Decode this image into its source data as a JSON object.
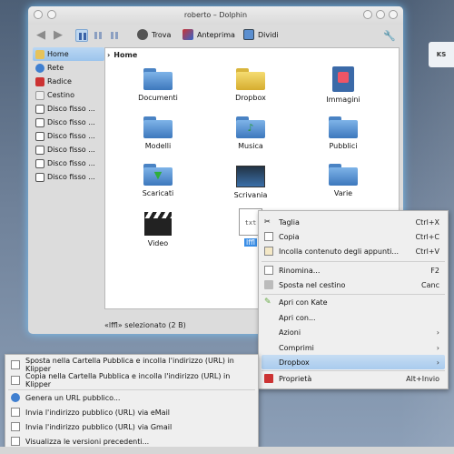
{
  "desktop": {
    "logo_text": "KS"
  },
  "window": {
    "title": "roberto – Dolphin",
    "toolbar": {
      "find_label": "Trova",
      "preview_label": "Anteprima",
      "split_label": "Dividi"
    },
    "sidebar": {
      "items": [
        {
          "label": "Home",
          "icon": "home-icon",
          "selected": true
        },
        {
          "label": "Rete",
          "icon": "network-icon"
        },
        {
          "label": "Radice",
          "icon": "root-icon"
        },
        {
          "label": "Cestino",
          "icon": "trash-icon"
        },
        {
          "label": "Disco fisso ...",
          "icon": "disk-icon"
        },
        {
          "label": "Disco fisso ...",
          "icon": "disk-icon"
        },
        {
          "label": "Disco fisso ...",
          "icon": "disk-icon"
        },
        {
          "label": "Disco fisso ...",
          "icon": "disk-icon"
        },
        {
          "label": "Disco fisso ...",
          "icon": "disk-icon"
        },
        {
          "label": "Disco fisso ...",
          "icon": "disk-icon"
        }
      ]
    },
    "breadcrumb": "Home",
    "files": [
      {
        "name": "Documenti"
      },
      {
        "name": "Dropbox"
      },
      {
        "name": "Immagini"
      },
      {
        "name": "Modelli"
      },
      {
        "name": "Musica"
      },
      {
        "name": "Pubblici"
      },
      {
        "name": "Scaricati"
      },
      {
        "name": "Scrivania"
      },
      {
        "name": "Varie"
      },
      {
        "name": "Video"
      },
      {
        "name": "lffl",
        "file_icon_text": "txt"
      }
    ],
    "status": "«lffl» selezionato (2 B)"
  },
  "context_menu": {
    "items": [
      {
        "label": "Taglia",
        "shortcut": "Ctrl+X"
      },
      {
        "label": "Copia",
        "shortcut": "Ctrl+C"
      },
      {
        "label": "Incolla contenuto degli appunti...",
        "shortcut": "Ctrl+V"
      },
      {
        "label": "Rinomina...",
        "shortcut": "F2"
      },
      {
        "label": "Sposta nel cestino",
        "shortcut": "Canc"
      },
      {
        "label": "Apri con Kate",
        "shortcut": ""
      },
      {
        "label": "Apri con...",
        "shortcut": ""
      },
      {
        "label": "Azioni",
        "shortcut": ""
      },
      {
        "label": "Comprimi",
        "shortcut": ""
      },
      {
        "label": "Dropbox",
        "shortcut": ""
      },
      {
        "label": "Proprietà",
        "shortcut": "Alt+Invio"
      }
    ],
    "submenu_arrow": "›"
  },
  "dropbox_submenu": {
    "items": [
      {
        "label": "Sposta nella Cartella Pubblica e incolla l'indirizzo (URL) in Klipper"
      },
      {
        "label": "Copia nella Cartella Pubblica e incolla l'indirizzo (URL) in Klipper"
      },
      {
        "label": "Genera un URL pubblico..."
      },
      {
        "label": "Invia l'indirizzo pubblico (URL) via eMail"
      },
      {
        "label": "Invia l'indirizzo pubblico (URL) via Gmail"
      },
      {
        "label": "Visualizza le versioni precedenti..."
      }
    ]
  },
  "colors": {
    "accent": "#3a8ee6",
    "selection": "#a9cbee",
    "glow": "#78c8ff"
  }
}
